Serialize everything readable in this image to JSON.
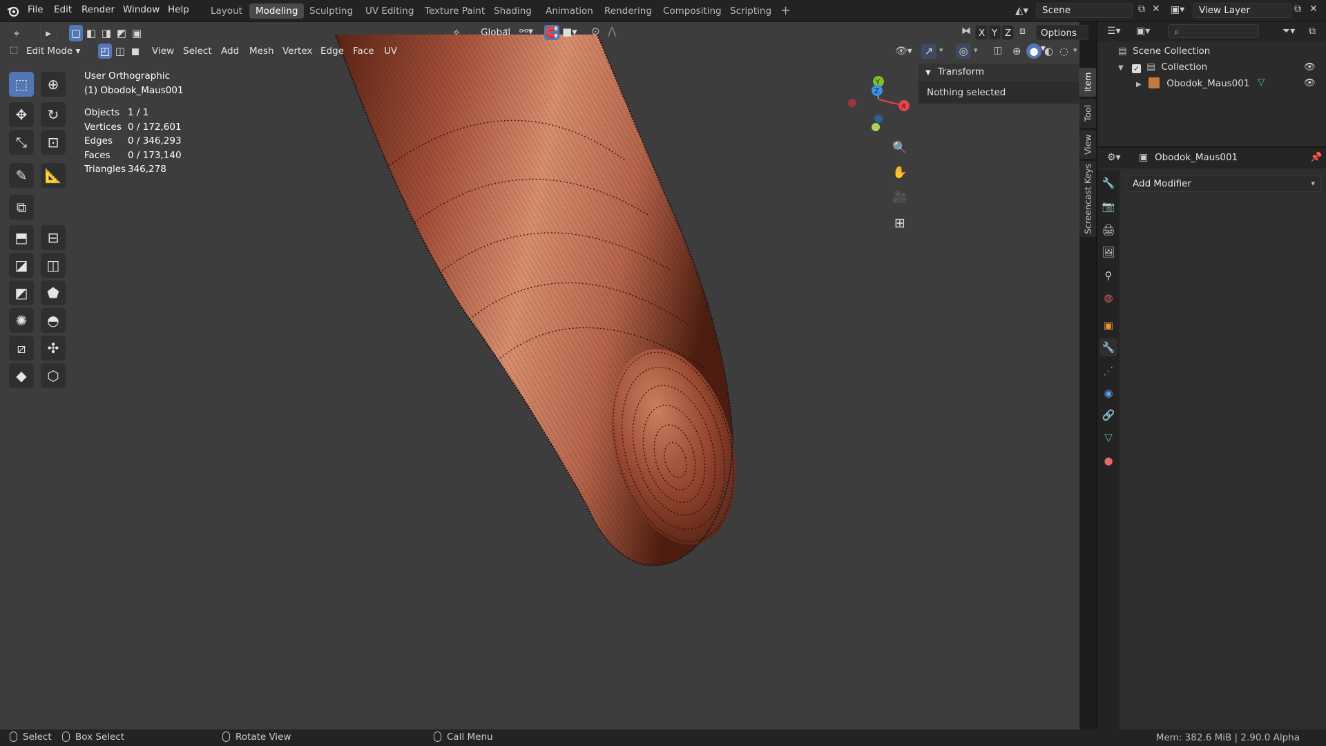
{
  "app": {
    "menus": [
      "File",
      "Edit",
      "Render",
      "Window",
      "Help"
    ],
    "workspaces": [
      "Layout",
      "Modeling",
      "Sculpting",
      "UV Editing",
      "Texture Paint",
      "Shading",
      "Animation",
      "Rendering",
      "Compositing",
      "Scripting"
    ],
    "active_workspace": "Modeling",
    "scene_name": "Scene",
    "view_layer": "View Layer"
  },
  "viewport_header": {
    "orientation": "Global",
    "options_label": "Options",
    "axis_x": "X",
    "axis_y": "Y",
    "axis_z": "Z",
    "mode": "Edit Mode",
    "menus": [
      "View",
      "Select",
      "Add",
      "Mesh",
      "Vertex",
      "Edge",
      "Face",
      "UV"
    ]
  },
  "overlay": {
    "view_name": "User Orthographic",
    "object_line": "(1) Obodok_Maus001",
    "stats": [
      {
        "label": "Objects",
        "value": "1 / 1"
      },
      {
        "label": "Vertices",
        "value": "0 / 172,601"
      },
      {
        "label": "Edges",
        "value": "0 / 346,293"
      },
      {
        "label": "Faces",
        "value": "0 / 173,140"
      },
      {
        "label": "Triangles",
        "value": "346,278"
      }
    ]
  },
  "gizmo": {
    "x": "X",
    "y": "Y",
    "z": "Z"
  },
  "npanel": {
    "section_title": "Transform",
    "message": "Nothing selected",
    "tabs": [
      "Item",
      "Tool",
      "View",
      "Screencast Keys"
    ]
  },
  "outliner": {
    "root": "Scene Collection",
    "collection": "Collection",
    "object": "Obodok_Maus001"
  },
  "properties": {
    "object_name": "Obodok_Maus001",
    "add_modifier": "Add Modifier"
  },
  "statusbar": {
    "select": "Select",
    "box_select": "Box Select",
    "rotate_view": "Rotate View",
    "call_menu": "Call Menu",
    "info": "Mem: 382.6 MiB | 2.90.0 Alpha"
  },
  "colors": {
    "accent": "#5377b5",
    "mesh_base": "#a9543a",
    "mesh_highlight": "#d99273",
    "axis_x": "#e8434f",
    "axis_y": "#7fbf2c",
    "axis_z": "#3b8fe8"
  }
}
